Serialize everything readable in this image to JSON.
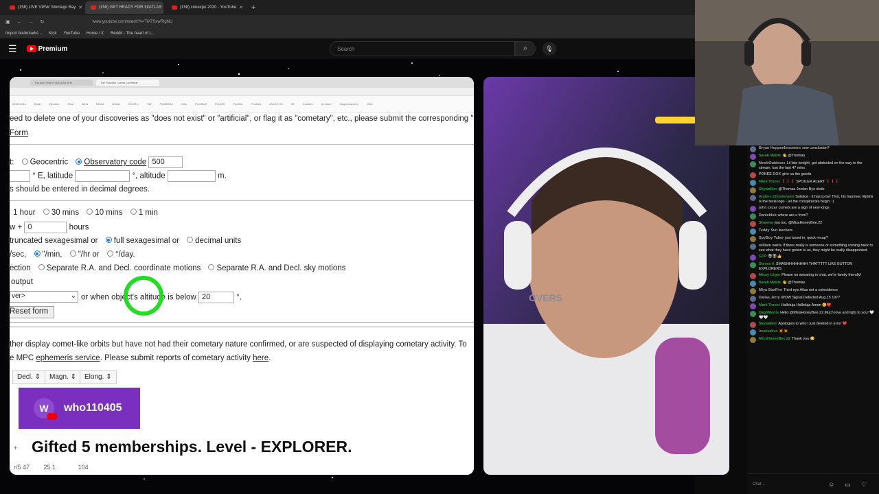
{
  "browser": {
    "tabs": [
      {
        "title": "(158) LIVE VIEW: Montego Bay",
        "active": false
      },
      {
        "title": "(158) GET READY FOR 3I/ATLAS",
        "active": true
      },
      {
        "title": "(158) conexpo 2020 - YouTube",
        "active": false
      }
    ],
    "new_tab": "+",
    "url": "www.youtube.com/watch?v=TM7SxwRigNU",
    "bookmarks": [
      "Import bookmarks...",
      "Kick",
      "YouTube",
      "Home / X",
      "Reddit - The heart of t..."
    ]
  },
  "youtube": {
    "logo": "Premium",
    "search_placeholder": "Search",
    "menu_icon": "hamburger-icon",
    "search_icon": "search-icon",
    "mic_icon": "mic-icon"
  },
  "inner_page": {
    "tabs": [
      "The Acid Test of 3I/ATLAS at H",
      "The Possible Comet Confirmat"
    ],
    "bookmarks": [
      "2025/10/14",
      "Earth",
      "Weather",
      "Dust",
      "Wind",
      "NOAA",
      "NOAA",
      "CCOR-1",
      "SW",
      "FireBBOM",
      "Helio",
      "PredSat2",
      "PredGS",
      "PredGA",
      "ProdSat",
      "LASCO C2",
      "SE",
      "Kanalen",
      "AI Index",
      "Magnetosphere",
      "MAC"
    ],
    "line1": "eed to delete one of your discoveries as \"does not exist\" or \"artificial\", or flag it as \"cometary\", etc., please submit the corresponding \"",
    "form_link": "Form",
    "loc_prefix": "t:",
    "geocentric": "Geocentric",
    "observatory_code": "Observatory code",
    "observatory_value": "500",
    "e_latitude": "° E, latitude",
    "altitude": "°, altitude",
    "m": "m.",
    "decimal_note": "s should be entered in decimal degrees.",
    "int_1hour": "1 hour",
    "int_30": "30 mins",
    "int_10": "10 mins",
    "int_1": "1 min",
    "w_plus": "w +",
    "hours_value": "0",
    "hours": "hours",
    "fmt_trunc": "truncated sexagesimal or",
    "fmt_full": "full sexagesimal or",
    "fmt_dec": "decimal units",
    "motion_prefix": "/sec,",
    "motion_min": "\"/min,",
    "motion_hr": "\"/hr or",
    "motion_day": "°/day.",
    "sep_prefix": "ection",
    "sep_ra_coord": "Separate R.A. and Decl. coordinate motions",
    "sep_ra_sky": "Separate R.A. and Decl. sky motions",
    "output": "output",
    "select_value": "ver>",
    "when_object": "or when object's altitude is below",
    "alt_value": "20",
    "deg": "°.",
    "reset": "Reset form",
    "para1": "ther display comet-like orbits but have not had their cometary nature confirmed, or are suspected of displaying cometary activity. To",
    "para2_pre": "e MPC",
    "ephemeris_link": "ephemeris service",
    "para2_mid": ". Please submit reports of cometary activity",
    "here_link": "here",
    "para2_end": ".",
    "col_decl": "Decl.",
    "col_magn": "Magn.",
    "col_elong": "Elong.",
    "row_partial": [
      "r/5 47",
      "25.1",
      "104"
    ],
    "plus": "+"
  },
  "gift": {
    "avatar_letter": "W",
    "username": "who110405",
    "message": "Gifted 5 memberships. Level - EXPLORER."
  },
  "camera_overlay_text": "OVERS",
  "chat": {
    "placeholder": "Chat...",
    "messages": [
      {
        "name": "Bryan Hoppenbrouwers",
        "text": "sow conclusion?",
        "color": "#aaaaaa"
      },
      {
        "name": "Sarah Mattle",
        "text": "👋 @Thomas",
        "color": "#2ba640"
      },
      {
        "name": "NewbOutdoors",
        "text": "Lil late tonight, got abducted on the way to the stream. lost the last 47 mins",
        "color": "#aaaaaa"
      },
      {
        "name": "POKEE DOX",
        "text": "give us the goods",
        "color": "#aaaaaa"
      },
      {
        "name": "Mark Troost",
        "text": "❗❗❗ SPOILER ALERT ❗❗❗",
        "color": "#2ba640"
      },
      {
        "name": "Skywalker",
        "text": "@Thomas Jordan Bye dude",
        "color": "#2ba640"
      },
      {
        "name": "Anders Christensen",
        "text": "Solstice - it has to be! Thor, his hammer, Mjölnir is the tesla logo - let the conspiracies begin. :)",
        "color": "#2ba640"
      },
      {
        "name": "john cezar",
        "text": "comets are a sign of new kings",
        "color": "#aaaaaa"
      },
      {
        "name": "Danieldsb",
        "text": "where are u from?",
        "color": "#aaaaaa"
      },
      {
        "name": "Shawna",
        "text": "you too, @MissHoneyBee.22",
        "color": "#2ba640"
      },
      {
        "name": "Teddy",
        "text": "Sun leechers",
        "color": "#aaaaaa"
      },
      {
        "name": "SpyBoy Tuber",
        "text": "just tuned in, quick recap?",
        "color": "#aaaaaa"
      },
      {
        "name": "william watts",
        "text": "If there really is someone or something coming back to see what they have grown ie us, they might be really disappointed.",
        "color": "#aaaaaa"
      },
      {
        "name": "GTP",
        "text": "👽👽👍",
        "color": "#2ba640"
      },
      {
        "name": "Steven A",
        "text": "SMASHHHHHHHH THATTTTT LIKE BUTTON EXPLORERS",
        "color": "#2ba640"
      },
      {
        "name": "Missy Léger",
        "text": "Please no swearing in chat, we're family friendly!",
        "color": "#2ba640"
      },
      {
        "name": "Sarah Mattle",
        "text": "👋 @Thomas",
        "color": "#2ba640"
      },
      {
        "name": "Miya StarFire",
        "text": "Third eye Atlas not a coincidence",
        "color": "#aaaaaa"
      },
      {
        "name": "Dallas Jerry",
        "text": "WOW Signal Detected Aug.15 1977",
        "color": "#aaaaaa"
      },
      {
        "name": "Mark Troost",
        "text": "Halleluja Halleluja Amen 😊❤️",
        "color": "#2ba640"
      },
      {
        "name": "DaphMents",
        "text": "Hello @MissHoneyBee.22 Much love and light to you! 🤍🤍🤍",
        "color": "#2ba640"
      },
      {
        "name": "Skywalker",
        "text": "Apologies to who I just deleted in error ❤️",
        "color": "#2ba640"
      },
      {
        "name": "loveisalive",
        "text": "✴️✴️",
        "color": "#2ba640"
      },
      {
        "name": "MissHoneyBee.22",
        "text": "Thank you 😊",
        "color": "#2ba640"
      }
    ]
  }
}
